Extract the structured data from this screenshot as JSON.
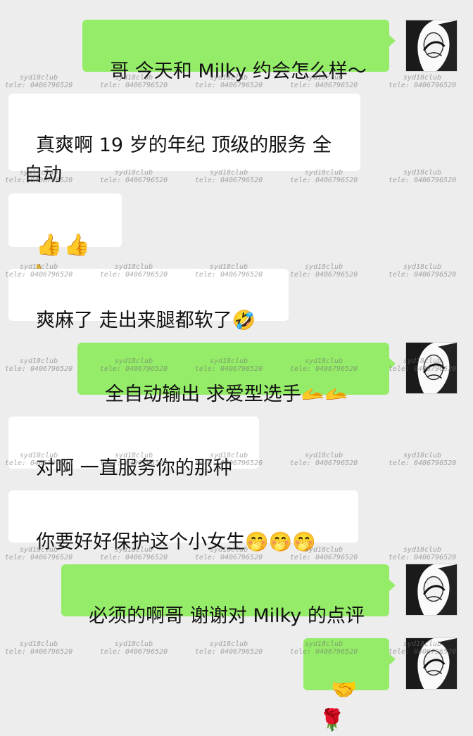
{
  "watermark": {
    "line1": "syd18club",
    "line2": "tele: 0406796520"
  },
  "messages": [
    {
      "side": "out",
      "text": "哥 今天和 Milky 约会怎么样～"
    },
    {
      "side": "in",
      "text": "真爽啊 19 岁的年纪 顶级的服务 全自动"
    },
    {
      "side": "in",
      "text": "👍👍👍"
    },
    {
      "side": "in",
      "text": "爽麻了 走出来腿都软了🤣"
    },
    {
      "side": "out",
      "text": "全自动输出 求爱型选手🫴🫴"
    },
    {
      "side": "in",
      "text": "对啊 一直服务你的那种"
    },
    {
      "side": "in",
      "text": "你要好好保护这个小女生🤭🤭🤭"
    },
    {
      "side": "out",
      "text": "必须的啊哥 谢谢对 Milky 的点评"
    },
    {
      "side": "out",
      "text": "🤝🌹"
    }
  ],
  "colors": {
    "background": "#ededed",
    "incoming_bubble": "#ffffff",
    "outgoing_bubble": "#95ec69"
  },
  "icons": {
    "avatar": "avatar-portrait-icon"
  }
}
